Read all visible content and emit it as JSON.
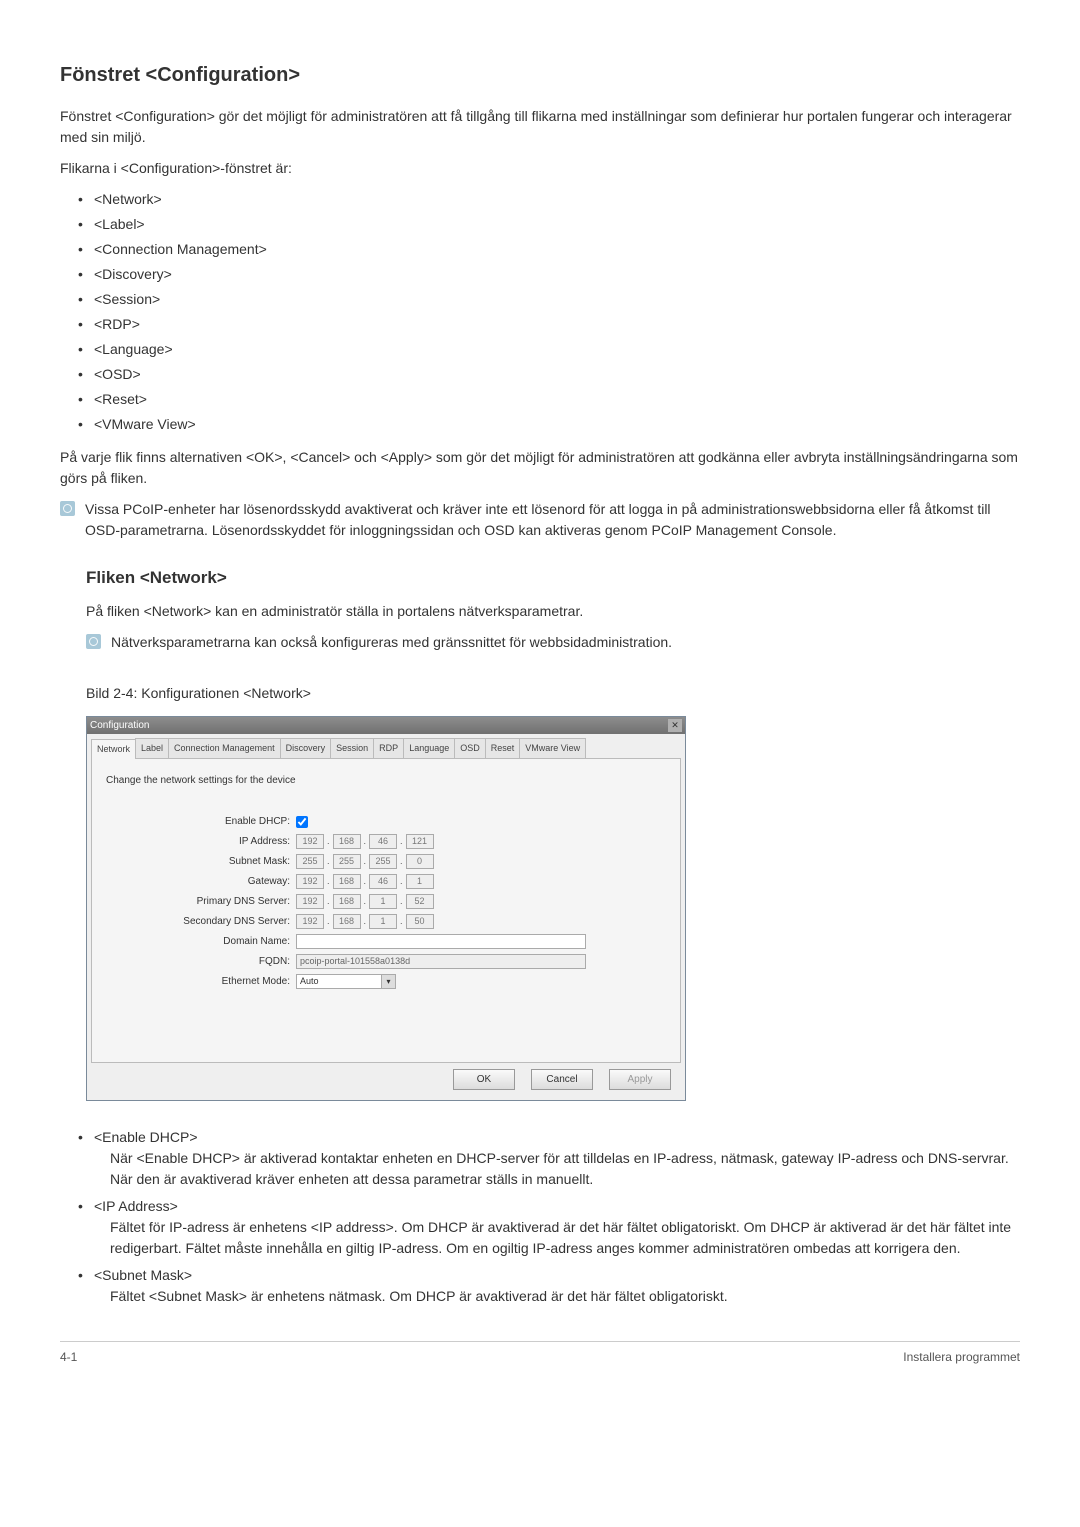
{
  "title": "Fönstret <Configuration>",
  "intro1": "Fönstret <Configuration> gör det möjligt för administratören att få tillgång till flikarna med inställningar som definierar hur portalen fungerar och interagerar med sin miljö.",
  "intro2": "Flikarna i <Configuration>-fönstret är:",
  "tabs_list": [
    "<Network>",
    "<Label>",
    "<Connection Management>",
    "<Discovery>",
    "<Session>",
    "<RDP>",
    "<Language>",
    "<OSD>",
    "<Reset>",
    "<VMware View>"
  ],
  "after_list": "På varje flik finns alternativen <OK>, <Cancel> och <Apply> som gör det möjligt för administratören att godkänna eller avbryta inställningsändringarna som görs på fliken.",
  "note1": "Vissa PCoIP-enheter har lösenordsskydd avaktiverat och kräver inte ett lösenord för att logga in på administrationswebbsidorna eller få åtkomst till OSD-parametrarna. Lösenordsskyddet för inloggningssidan och OSD kan aktiveras genom PCoIP Management Console.",
  "network_heading": "Fliken <Network>",
  "network_intro": "På fliken <Network> kan en administratör ställa in portalens nätverksparametrar.",
  "note2": "Nätverksparametrarna kan också konfigureras med gränssnittet för webbsidadministration.",
  "figure_caption": "Bild 2-4: Konfigurationen <Network>",
  "dialog": {
    "title": "Configuration",
    "tabs": [
      "Network",
      "Label",
      "Connection Management",
      "Discovery",
      "Session",
      "RDP",
      "Language",
      "OSD",
      "Reset",
      "VMware View"
    ],
    "desc": "Change the network settings for the device",
    "labels": {
      "enable_dhcp": "Enable DHCP:",
      "ip": "IP Address:",
      "subnet": "Subnet Mask:",
      "gateway": "Gateway:",
      "pdns": "Primary DNS Server:",
      "sdns": "Secondary DNS Server:",
      "domain": "Domain Name:",
      "fqdn": "FQDN:",
      "ethernet": "Ethernet Mode:"
    },
    "values": {
      "ip": [
        "192",
        "168",
        "46",
        "121"
      ],
      "subnet": [
        "255",
        "255",
        "255",
        "0"
      ],
      "gateway": [
        "192",
        "168",
        "46",
        "1"
      ],
      "pdns": [
        "192",
        "168",
        "1",
        "52"
      ],
      "sdns": [
        "192",
        "168",
        "1",
        "50"
      ],
      "domain": "",
      "fqdn": "pcoip-portal-101558a0138d",
      "ethernet": "Auto"
    },
    "buttons": {
      "ok": "OK",
      "cancel": "Cancel",
      "apply": "Apply"
    }
  },
  "fields": [
    {
      "term": "<Enable DHCP>",
      "desc": "När <Enable DHCP> är aktiverad kontaktar enheten en DHCP-server för att tilldelas en IP-adress, nätmask, gateway IP-adress och DNS-servrar. När den är avaktiverad kräver enheten att dessa parametrar ställs in manuellt."
    },
    {
      "term": "<IP Address>",
      "desc": "Fältet för IP-adress är enhetens <IP address>. Om DHCP är avaktiverad är det här fältet obligatoriskt. Om DHCP är aktiverad är det här fältet inte redigerbart. Fältet måste innehålla en giltig IP-adress. Om en ogiltig IP-adress anges kommer administratören ombedas att korrigera den."
    },
    {
      "term": "<Subnet Mask>",
      "desc": "Fältet <Subnet Mask> är enhetens nätmask. Om DHCP är avaktiverad är det här fältet obligatoriskt."
    }
  ],
  "footer": {
    "left": "4-1",
    "right": "Installera programmet"
  }
}
